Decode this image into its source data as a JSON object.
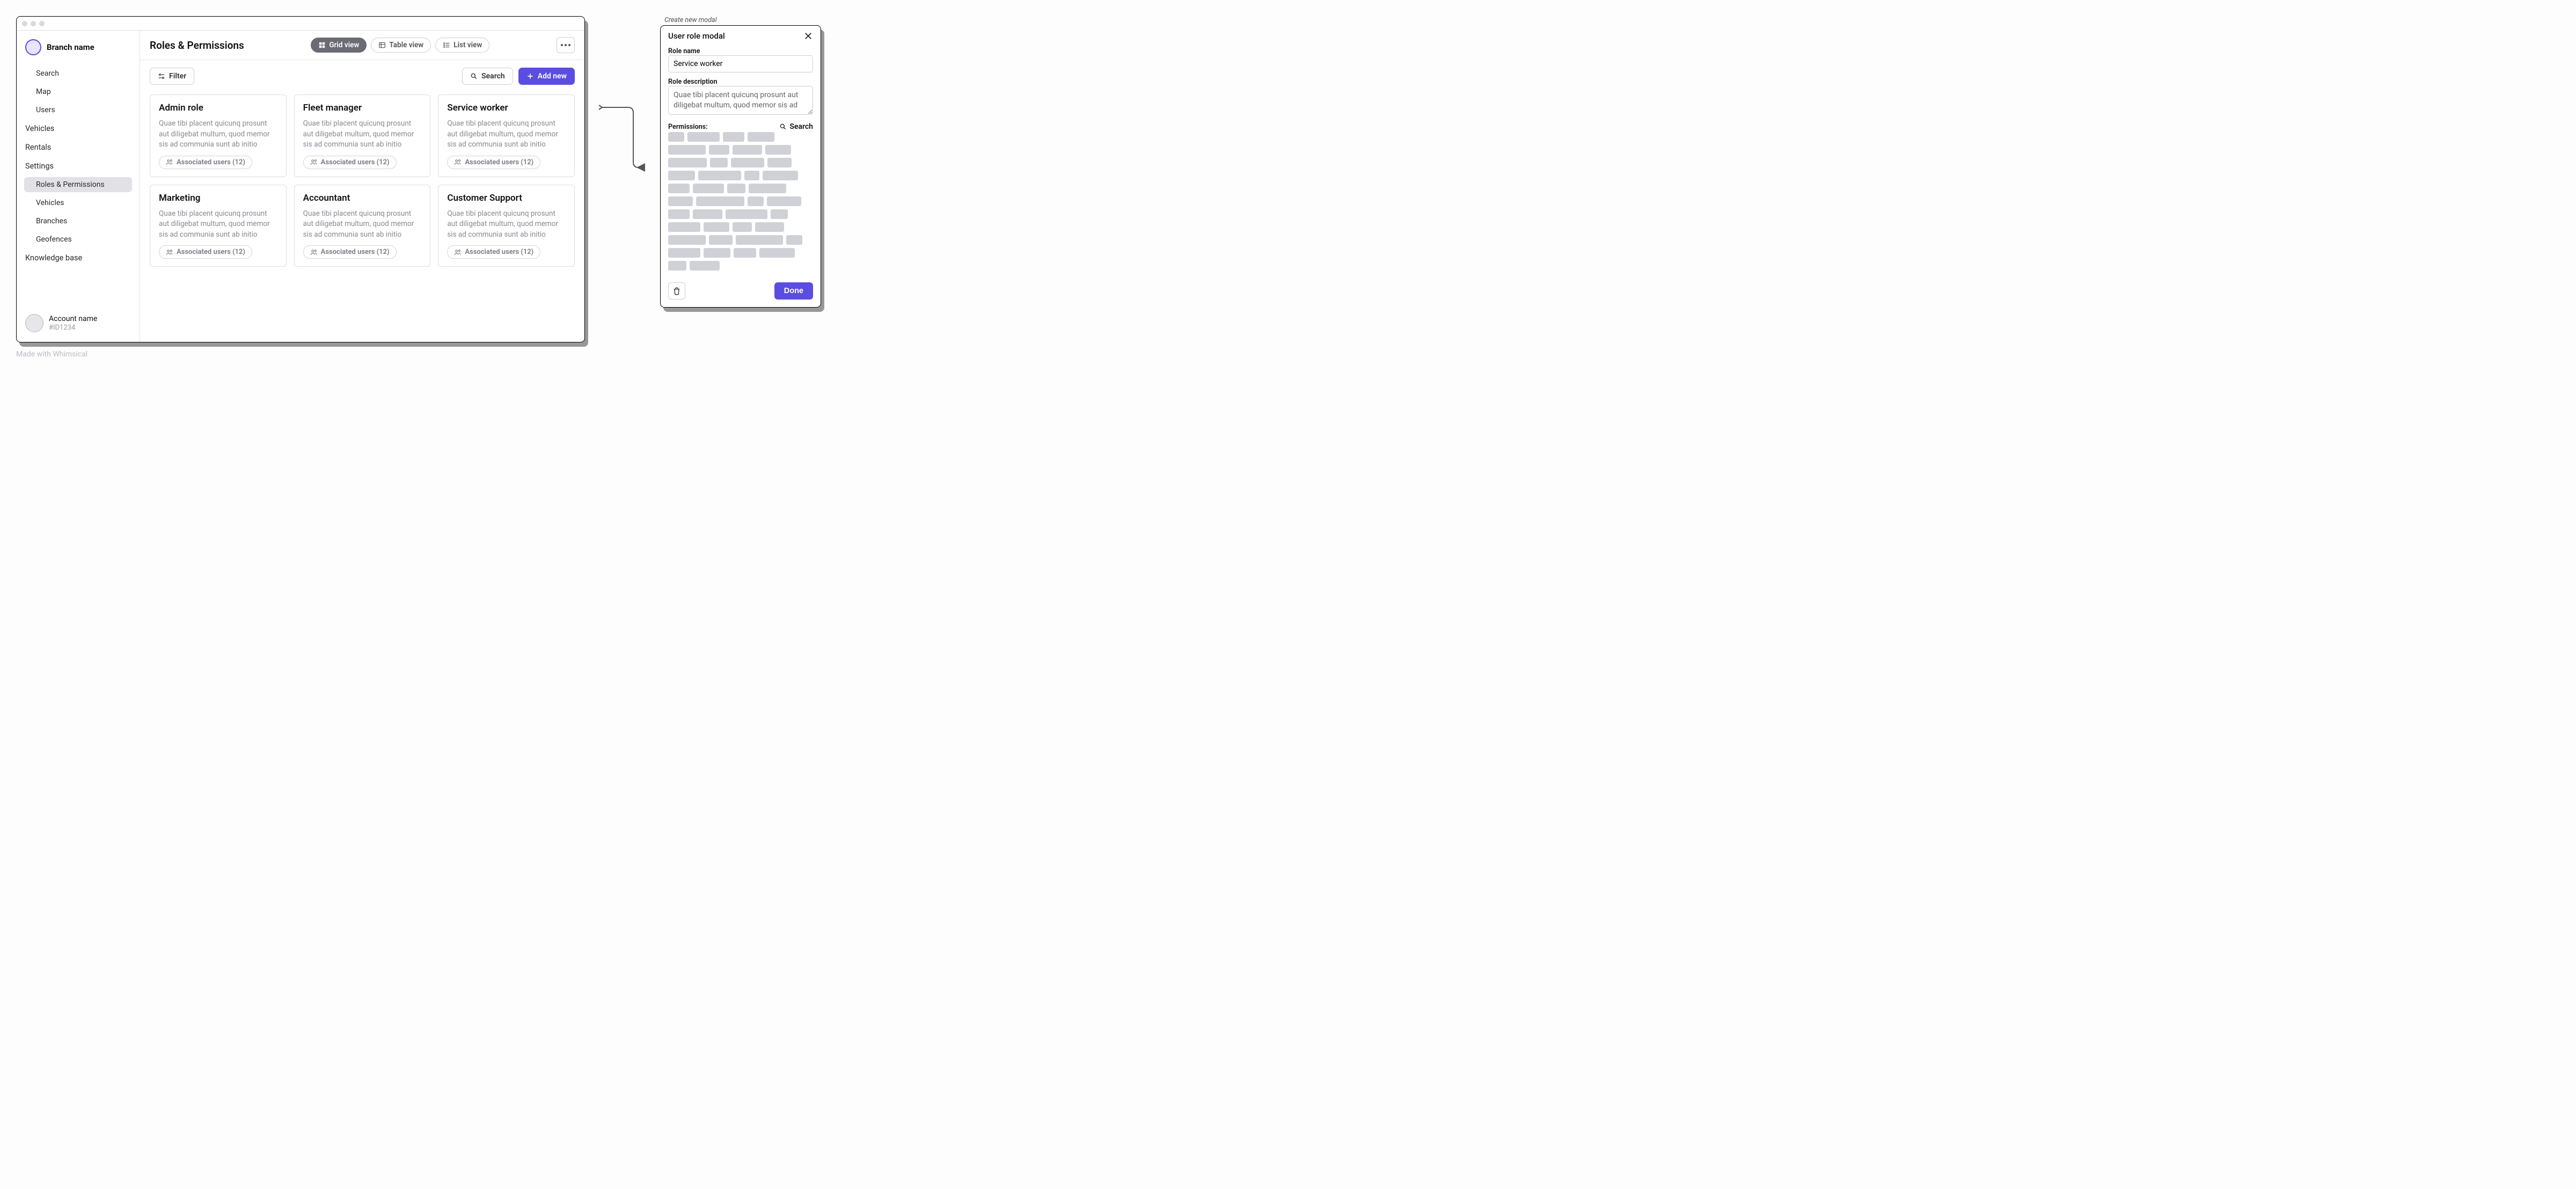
{
  "sidebar": {
    "branch_name": "Branch name",
    "nav": [
      {
        "label": "Search",
        "type": "child"
      },
      {
        "label": "Map",
        "type": "child"
      },
      {
        "label": "Users",
        "type": "child"
      },
      {
        "label": "Vehicles",
        "type": "parent"
      },
      {
        "label": "Rentals",
        "type": "parent"
      },
      {
        "label": "Settings",
        "type": "parent"
      },
      {
        "label": "Roles & Permissions",
        "type": "child",
        "active": true
      },
      {
        "label": "Vehicles",
        "type": "child"
      },
      {
        "label": "Branches",
        "type": "child"
      },
      {
        "label": "Geofences",
        "type": "child"
      },
      {
        "label": "Knowledge base",
        "type": "parent"
      }
    ],
    "account": {
      "name": "Account name",
      "id": "#ID1234"
    }
  },
  "header": {
    "title": "Roles & Permissions",
    "views": [
      {
        "label": "Grid view",
        "active": true
      },
      {
        "label": "Table view",
        "active": false
      },
      {
        "label": "List view",
        "active": false
      }
    ]
  },
  "toolbar": {
    "filter": "Filter",
    "search": "Search",
    "add_new": "Add new"
  },
  "roles": [
    {
      "title": "Admin role",
      "desc": "Quae tibi placent quicunq prosunt aut diligebat multum, quod memor sis ad communia sunt ab initio",
      "chip": "Associated users (12)"
    },
    {
      "title": "Fleet manager",
      "desc": "Quae tibi placent quicunq prosunt aut diligebat multum, quod memor sis ad communia sunt ab initio",
      "chip": "Associated users (12)"
    },
    {
      "title": "Service worker",
      "desc": "Quae tibi placent quicunq prosunt aut diligebat multum, quod memor sis ad communia sunt ab initio",
      "chip": "Associated users (12)"
    },
    {
      "title": "Marketing",
      "desc": "Quae tibi placent quicunq prosunt aut diligebat multum, quod memor sis ad communia sunt ab initio",
      "chip": "Associated users (12)"
    },
    {
      "title": "Accountant",
      "desc": "Quae tibi placent quicunq prosunt aut diligebat multum, quod memor sis ad communia sunt ab initio",
      "chip": "Associated users (12)"
    },
    {
      "title": "Customer Support",
      "desc": "Quae tibi placent quicunq prosunt aut diligebat multum, quod memor sis ad communia sunt ab initio",
      "chip": "Associated users (12)"
    }
  ],
  "modal": {
    "annotation": "Create new modal",
    "title": "User role modal",
    "role_name_label": "Role name",
    "role_name_value": "Service worker",
    "role_desc_label": "Role description",
    "role_desc_value": "Quae tibi placent quicunq prosunt aut diligebat multum, quod memor sis ad",
    "permissions_label": "Permissions:",
    "permissions_search": "Search",
    "done": "Done",
    "placeholder_widths": [
      30,
      60,
      40,
      50,
      70,
      38,
      55,
      48,
      72,
      33,
      62,
      45,
      50,
      80,
      28,
      66,
      40,
      58,
      34,
      70,
      46,
      90,
      30,
      64,
      40,
      55,
      78,
      32,
      60,
      48,
      36,
      54,
      70,
      44,
      88,
      30,
      60,
      50,
      42,
      66,
      34,
      56
    ]
  },
  "watermark": "Made with Whimsical"
}
